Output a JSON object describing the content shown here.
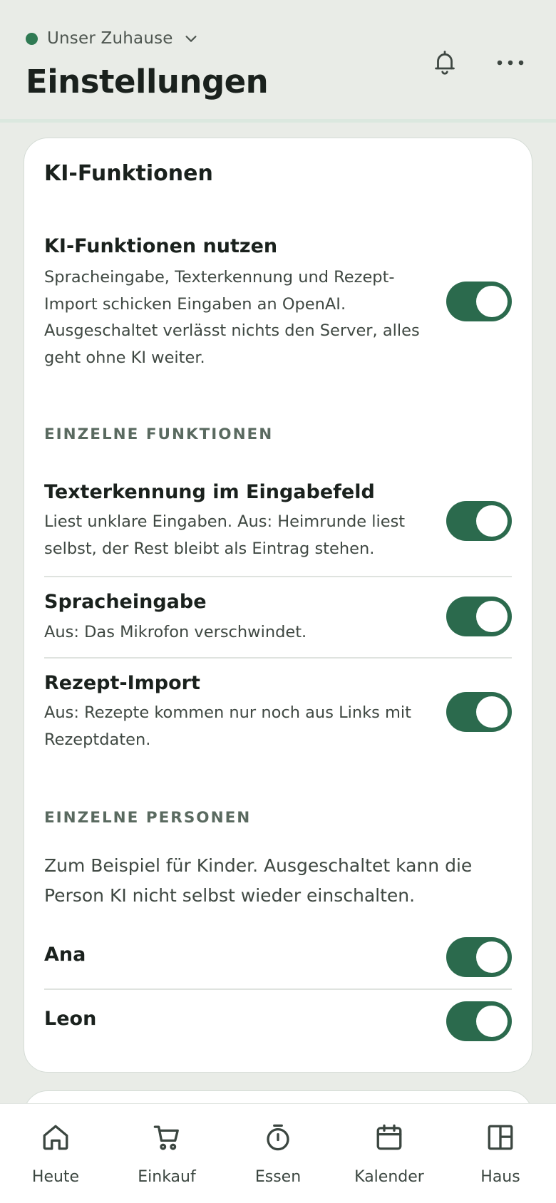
{
  "header": {
    "household": "Unser Zuhause",
    "status_color": "#2f7a53",
    "title": "Einstellungen",
    "icons": [
      "bell-icon",
      "more-icon"
    ]
  },
  "card": {
    "title": "KI-Funktionen",
    "master": {
      "title": "KI-Funktionen nutzen",
      "desc_lines": [
        "Spracheingabe, Texterkennung und Rezept-",
        "Import schicken Eingaben an OpenAI.",
        "Ausgeschaltet verlässt nichts den Server, alles",
        "geht ohne KI weiter."
      ],
      "enabled": true
    },
    "features_label": "EINZELNE FUNKTIONEN",
    "features": [
      {
        "title": "Texterkennung im Eingabefeld",
        "desc_lines": [
          "Liest unklare Eingaben. Aus: Heimrunde liest",
          "selbst, der Rest bleibt als Eintrag stehen."
        ],
        "enabled": true
      },
      {
        "title": "Spracheingabe",
        "desc_lines": [
          "Aus: Das Mikrofon verschwindet."
        ],
        "enabled": true
      },
      {
        "title": "Rezept-Import",
        "desc_lines": [
          "Aus: Rezepte kommen nur noch aus Links mit",
          "Rezeptdaten."
        ],
        "enabled": true
      }
    ],
    "persons_label": "EINZELNE PERSONEN",
    "persons_intro_lines": [
      "Zum Beispiel für Kinder. Ausgeschaltet kann die",
      "Person KI nicht selbst wieder einschalten."
    ],
    "persons": [
      {
        "name": "Ana",
        "enabled": true
      },
      {
        "name": "Leon",
        "enabled": true
      }
    ]
  },
  "nav": [
    {
      "label": "Heute",
      "icon": "home-icon"
    },
    {
      "label": "Einkauf",
      "icon": "cart-icon"
    },
    {
      "label": "Essen",
      "icon": "timer-icon"
    },
    {
      "label": "Kalender",
      "icon": "calendar-icon"
    },
    {
      "label": "Haus",
      "icon": "layout-icon"
    }
  ],
  "colors": {
    "accent": "#2b6a4d",
    "background": "#e9ece7",
    "card": "#ffffff"
  }
}
